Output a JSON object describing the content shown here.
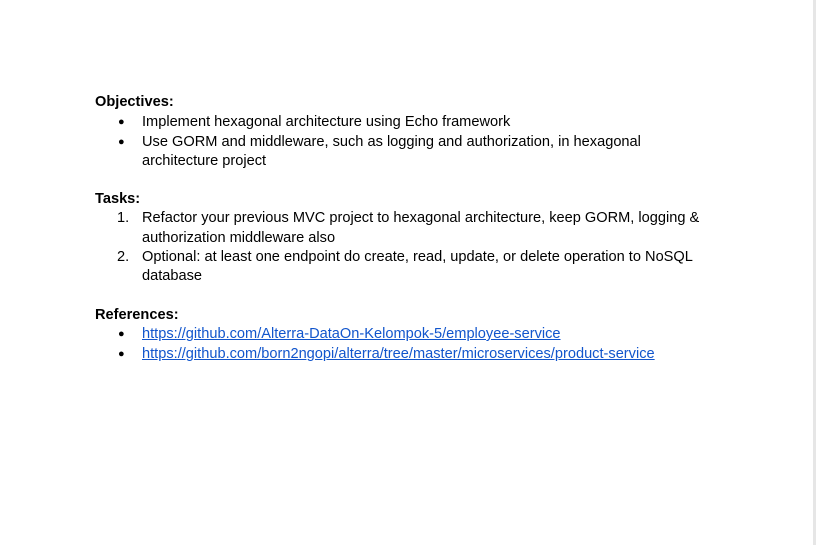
{
  "objectives": {
    "heading": "Objectives:",
    "bullet": "●",
    "items": [
      [
        "Implement hexagonal architecture using Echo framework"
      ],
      [
        "Use GORM and middleware, such as logging and authorization, in hexagonal",
        "architecture project"
      ]
    ]
  },
  "tasks": {
    "heading": "Tasks:",
    "items": [
      {
        "marker": "1.",
        "lines": [
          "Refactor your previous MVC project to hexagonal architecture, keep GORM, logging &",
          "authorization middleware also"
        ]
      },
      {
        "marker": "2.",
        "lines": [
          "Optional: at least one endpoint do create, read, update, or delete operation to NoSQL",
          "database"
        ]
      }
    ]
  },
  "references": {
    "heading": "References:",
    "bullet": "●",
    "links": [
      "https://github.com/Alterra-DataOn-Kelompok-5/employee-service",
      "https://github.com/born2ngopi/alterra/tree/master/microservices/product-service"
    ],
    "link_color": "#1155cc"
  }
}
